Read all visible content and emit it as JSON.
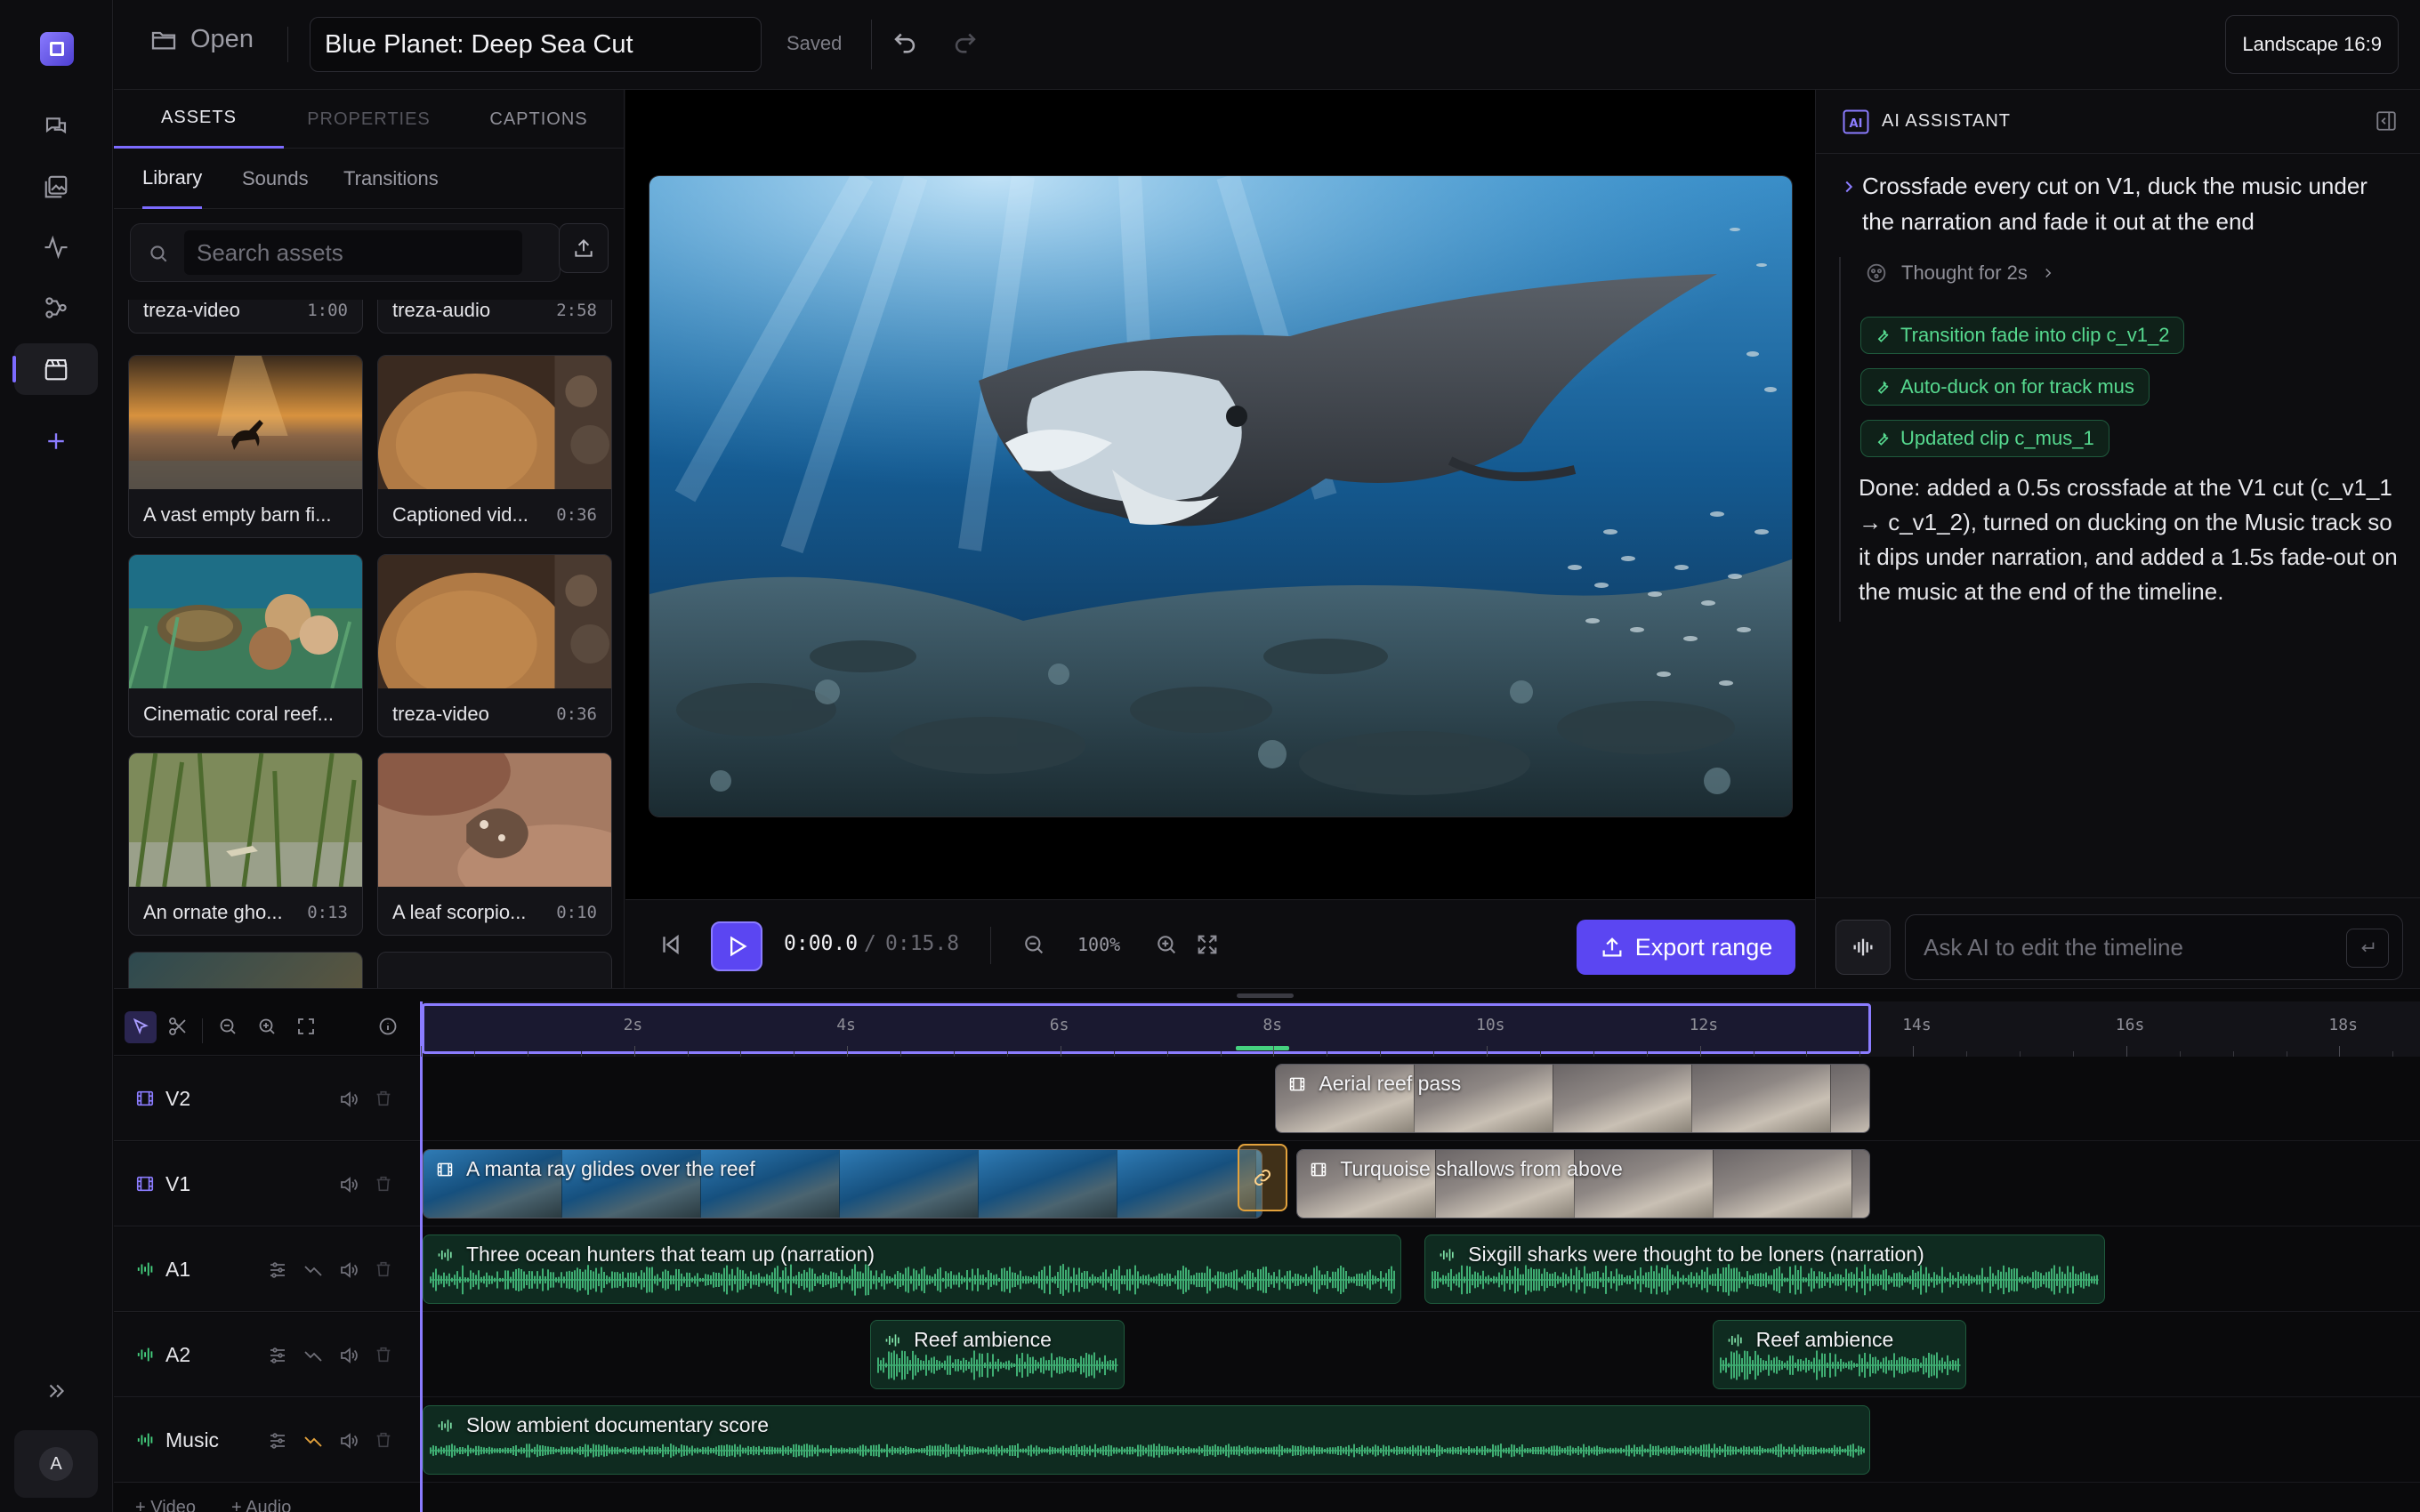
{
  "app": {
    "title": "Blue Planet: Deep Sea Cut",
    "save_status": "Saved",
    "open_label": "Open",
    "aspect_label": "Landscape 16:9",
    "avatar_initial": "A"
  },
  "left_panel": {
    "tabs": [
      {
        "label": "ASSETS",
        "active": true
      },
      {
        "label": "PROPERTIES",
        "active": false
      },
      {
        "label": "CAPTIONS",
        "active": false
      }
    ],
    "sub_tabs": [
      {
        "label": "Library",
        "active": true
      },
      {
        "label": "Sounds",
        "active": false
      },
      {
        "label": "Transitions",
        "active": false
      }
    ],
    "search_placeholder": "Search assets",
    "assets": [
      {
        "title": "treza-video",
        "duration": "1:00",
        "thumb": "partial"
      },
      {
        "title": "treza-audio",
        "duration": "2:58",
        "thumb": "partial"
      },
      {
        "title": "A vast empty barn fi...",
        "duration": "",
        "thumb": "sunset-horse"
      },
      {
        "title": "Captioned vid...",
        "duration": "0:36",
        "thumb": "coral"
      },
      {
        "title": "Cinematic coral reef...",
        "duration": "",
        "thumb": "turtle"
      },
      {
        "title": "treza-video",
        "duration": "0:36",
        "thumb": "coral"
      },
      {
        "title": "An ornate gho...",
        "duration": "0:13",
        "thumb": "seagrass"
      },
      {
        "title": "A leaf scorpio...",
        "duration": "0:10",
        "thumb": "scorpionfish"
      }
    ]
  },
  "preview": {
    "time_current": "0:00.0",
    "time_separator": "/",
    "time_total": "0:15.8",
    "zoom": "100%",
    "export_label": "Export range"
  },
  "ai": {
    "title": "AI ASSISTANT",
    "prompt": "Crossfade every cut on V1, duck the music under the narration and fade it out at the end",
    "thought": "Thought for 2s",
    "tool_calls": [
      "Transition fade into clip c_v1_2",
      "Auto-duck on for track mus",
      "Updated clip c_mus_1"
    ],
    "response": "Done: added a 0.5s crossfade at the V1 cut (c_v1_1 → c_v1_2), turned on ducking on the Music track so it dips under narration, and added a 1.5s fade-out on the music at the end of the timeline.",
    "input_placeholder": "Ask AI to edit the timeline"
  },
  "timeline": {
    "ruler_labels": [
      "2s",
      "4s",
      "6s",
      "8s",
      "10s",
      "12s",
      "14s",
      "16s",
      "18s"
    ],
    "playhead_seconds": 0,
    "range_end_seconds": 13.6,
    "tracks": [
      {
        "name": "V2",
        "kind": "video"
      },
      {
        "name": "V1",
        "kind": "video"
      },
      {
        "name": "A1",
        "kind": "audio"
      },
      {
        "name": "A2",
        "kind": "audio"
      },
      {
        "name": "Music",
        "kind": "audio"
      }
    ],
    "clips": {
      "v2_1": {
        "label": "Aerial reef pass",
        "start": 8.0,
        "end": 13.6
      },
      "v1_1": {
        "label": "A manta ray glides over the reef",
        "start": 0,
        "end": 7.9
      },
      "v1_2": {
        "label": "Turquoise shallows from above",
        "start": 8.2,
        "end": 13.6
      },
      "a1_1": {
        "label": "Three ocean hunters that team up (narration)",
        "start": 0,
        "end": 9.2
      },
      "a1_2": {
        "label": "Sixgill sharks were thought to be loners (narration)",
        "start": 9.4,
        "end": 15.8
      },
      "a2_1": {
        "label": "Reef ambience",
        "start": 4.2,
        "end": 6.6
      },
      "a2_2": {
        "label": "Reef ambience",
        "start": 12.1,
        "end": 14.5
      },
      "mus_1": {
        "label": "Slow ambient documentary score",
        "start": 0,
        "end": 13.6
      }
    },
    "add_video": "+ Video",
    "add_audio": "+ Audio"
  },
  "colors": {
    "accent": "#5b46f2",
    "audio": "#45d17f",
    "crossfade": "#e3a23c"
  }
}
